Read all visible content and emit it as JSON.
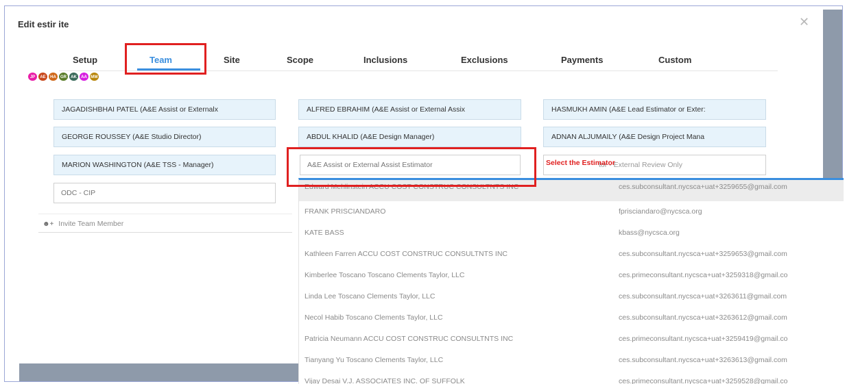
{
  "modal": {
    "title": "Edit estir  ite",
    "close_icon": "close-icon"
  },
  "tabs": [
    {
      "label": "Setup"
    },
    {
      "label": "Team"
    },
    {
      "label": "Site"
    },
    {
      "label": "Scope"
    },
    {
      "label": "Inclusions"
    },
    {
      "label": "Exclusions"
    },
    {
      "label": "Payments"
    },
    {
      "label": "Custom"
    }
  ],
  "active_tab": "Team",
  "avatars": [
    {
      "initials": "JP",
      "color": "#e91ea8"
    },
    {
      "initials": "AE",
      "color": "#c8481c"
    },
    {
      "initials": "HA",
      "color": "#d0681a"
    },
    {
      "initials": "GR",
      "color": "#5a7d2a"
    },
    {
      "initials": "AK",
      "color": "#3a6a5a"
    },
    {
      "initials": "AA",
      "color": "#d61ee0"
    },
    {
      "initials": "MW",
      "color": "#b8860b"
    }
  ],
  "team_members": [
    "JAGADISHBHAI PATEL (A&E Assist or Externalx",
    "ALFRED EBRAHIM (A&E Assist or External Assix",
    "HASMUKH AMIN (A&E Lead Estimator or Exter:",
    "GEORGE ROUSSEY (A&E Studio Director)",
    "ABDUL KHALID (A&E Design Manager)",
    "ADNAN ALJUMAILY (A&E Design Project Mana",
    "MARION WASHINGTON (A&E TSS - Manager)"
  ],
  "estimator_input": {
    "placeholder": "A&E Assist or External Assist Estimator"
  },
  "external_review": {
    "annotation": "Select the Estimator",
    "text": "tor - External Review Only"
  },
  "odc_input": {
    "placeholder": "ODC - CIP"
  },
  "invite": {
    "label": "Invite Team Member",
    "icon": "user-add-icon"
  },
  "dropdown": [
    {
      "name": "Edward Mehlinstein ACCU COST CONSTRUC CONSULTNTS INC",
      "email": "ces.subconsultant.nycsca+uat+3259655@gmail.com"
    },
    {
      "name": "FRANK PRISCIANDARO",
      "email": "fprisciandaro@nycsca.org"
    },
    {
      "name": "KATE BASS",
      "email": "kbass@nycsca.org"
    },
    {
      "name": "Kathleen Farren ACCU COST CONSTRUC CONSULTNTS INC",
      "email": "ces.subconsultant.nycsca+uat+3259653@gmail.com"
    },
    {
      "name": "Kimberlee Toscano Toscano Clements Taylor, LLC",
      "email": "ces.primeconsultant.nycsca+uat+3259318@gmail.co"
    },
    {
      "name": "Linda Lee Toscano Clements Taylor, LLC",
      "email": "ces.subconsultant.nycsca+uat+3263611@gmail.com"
    },
    {
      "name": "Necol Habib Toscano Clements Taylor, LLC",
      "email": "ces.subconsultant.nycsca+uat+3263612@gmail.com"
    },
    {
      "name": "Patricia Neumann ACCU COST CONSTRUC CONSULTNTS INC",
      "email": "ces.primeconsultant.nycsca+uat+3259419@gmail.co"
    },
    {
      "name": "Tianyang Yu Toscano Clements Taylor, LLC",
      "email": "ces.subconsultant.nycsca+uat+3263613@gmail.com"
    },
    {
      "name": "Vijay Desai V.J. ASSOCIATES INC. OF SUFFOLK",
      "email": "ces.primeconsultant.nycsca+uat+3259528@gmail.co"
    }
  ],
  "colors": {
    "accent": "#3a8ede",
    "annotation_red": "#e02020",
    "chip_bg": "#e7f3fb",
    "backdrop": "#8e9aaa"
  }
}
